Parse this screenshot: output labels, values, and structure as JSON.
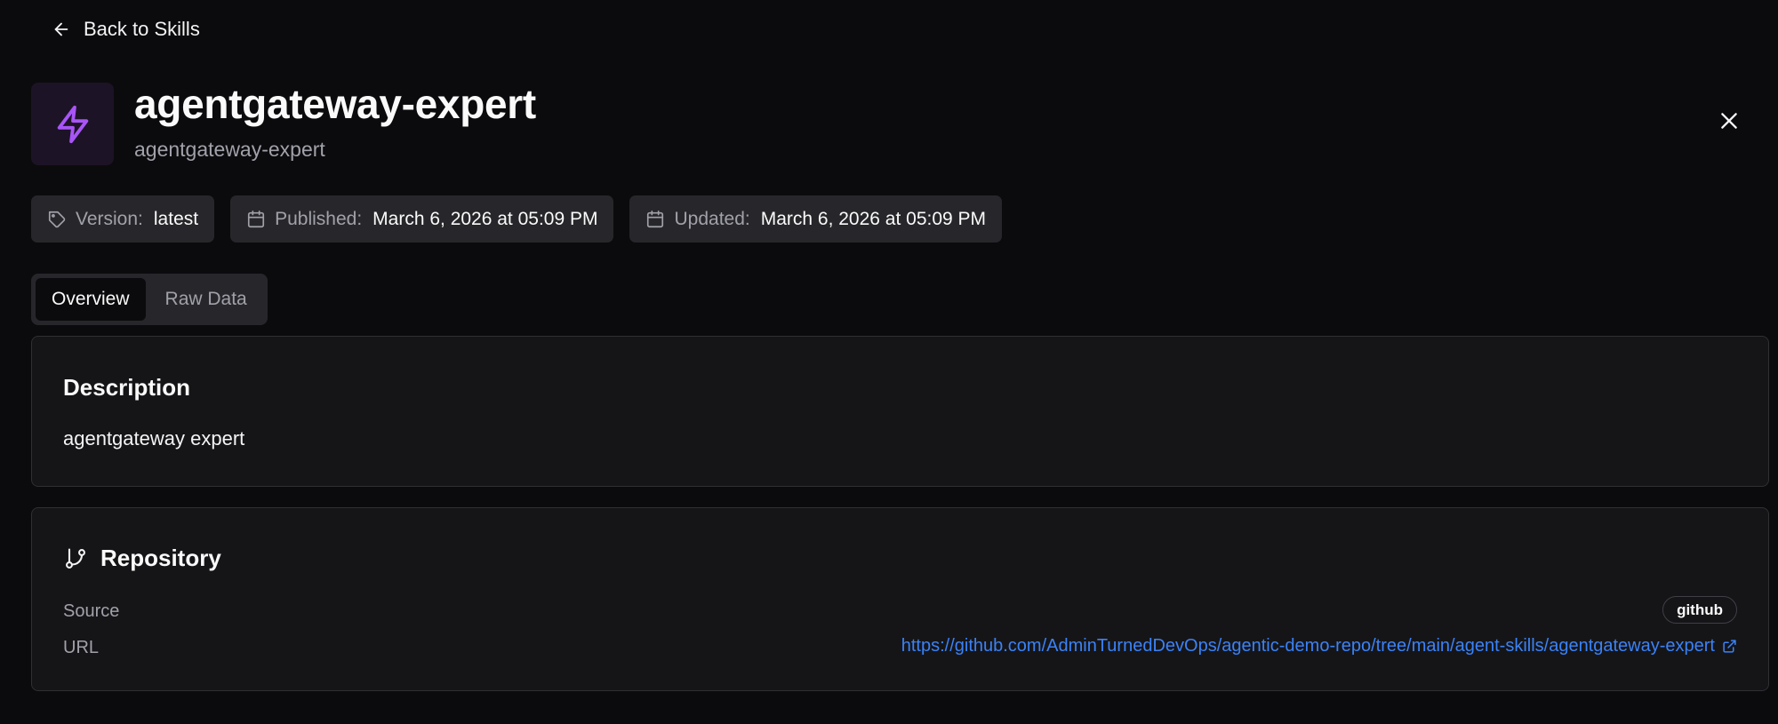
{
  "nav": {
    "back_label": "Back to Skills"
  },
  "header": {
    "title": "agentgateway-expert",
    "subtitle": "agentgateway-expert"
  },
  "meta": {
    "version": {
      "label": "Version:",
      "value": "latest"
    },
    "published": {
      "label": "Published:",
      "value": "March 6, 2026 at 05:09 PM"
    },
    "updated": {
      "label": "Updated:",
      "value": "March 6, 2026 at 05:09 PM"
    }
  },
  "tabs": [
    {
      "label": "Overview",
      "active": true
    },
    {
      "label": "Raw Data",
      "active": false
    }
  ],
  "description": {
    "heading": "Description",
    "text": "agentgateway expert"
  },
  "repository": {
    "heading": "Repository",
    "source_label": "Source",
    "source_value": "github",
    "url_label": "URL",
    "url_value": "https://github.com/AdminTurnedDevOps/agentic-demo-repo/tree/main/agent-skills/agentgateway-expert"
  },
  "icons": {
    "back": "arrow-left-icon",
    "logo": "lightning-bolt-icon",
    "close": "close-icon",
    "version": "tag-icon",
    "published": "calendar-icon",
    "updated": "calendar-icon",
    "repository": "git-branch-icon",
    "external": "external-link-icon"
  },
  "colors": {
    "background": "#0b0b0d",
    "card": "#151518",
    "chip": "#27272b",
    "accent_purple": "#a855f7",
    "link_blue": "#3b82f6"
  }
}
